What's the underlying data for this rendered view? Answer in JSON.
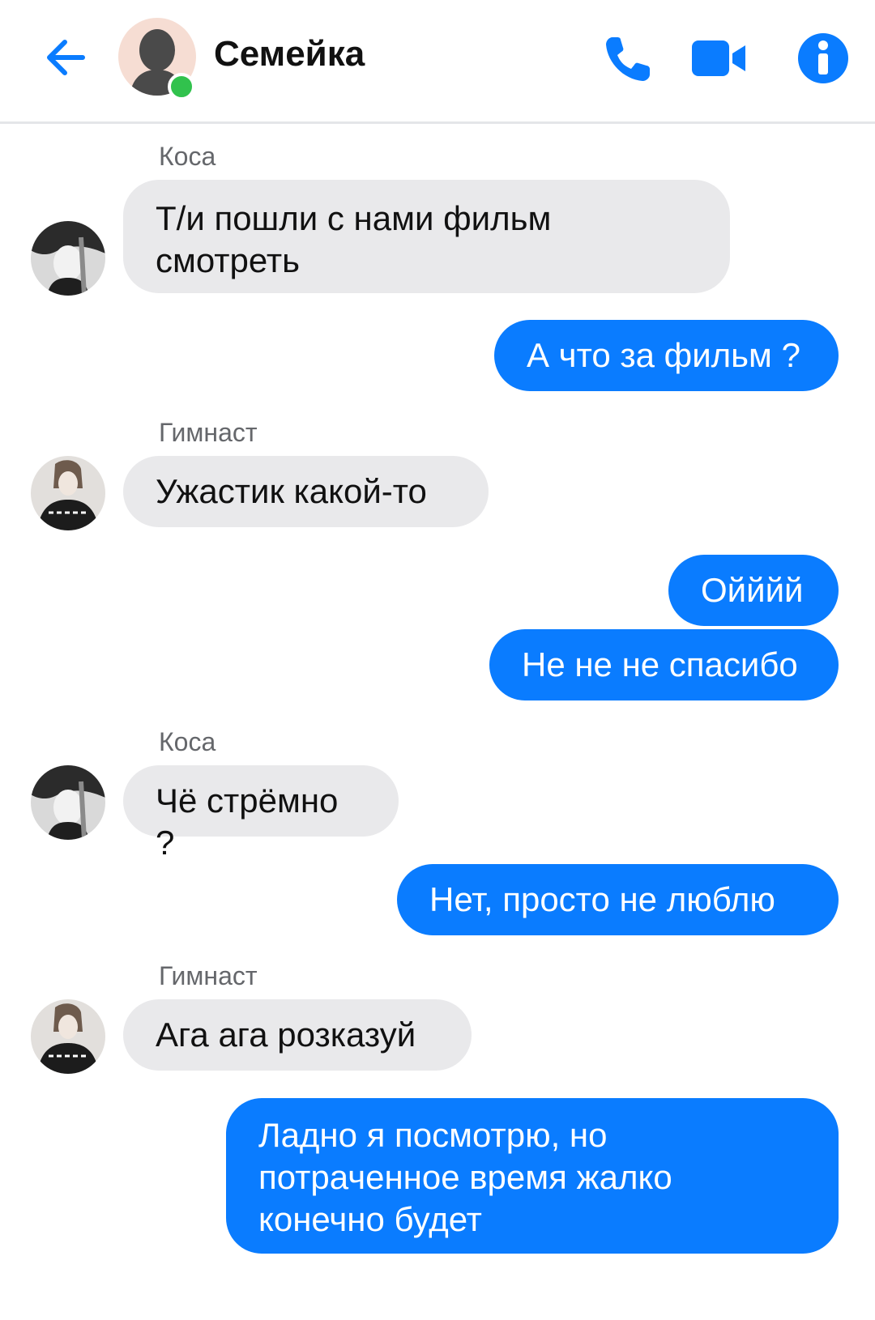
{
  "header": {
    "title": "Семейка",
    "back_icon": "arrow-left-icon",
    "call_icon": "phone-icon",
    "video_icon": "video-camera-icon",
    "info_icon": "info-icon",
    "accent_color": "#0a7cff",
    "online_color": "#31c24d"
  },
  "messages": [
    {
      "sender": "Коса",
      "text": "Т/и пошли с нами фильм смотреть",
      "direction": "incoming"
    },
    {
      "text": "А что за фильм ?",
      "direction": "outgoing"
    },
    {
      "sender": "Гимнаст",
      "text": "Ужастик какой-то",
      "direction": "incoming"
    },
    {
      "text": "Ойййй",
      "direction": "outgoing"
    },
    {
      "text": "Не не не спасибо",
      "direction": "outgoing"
    },
    {
      "sender": "Коса",
      "text": "Чё стрёмно ?",
      "direction": "incoming"
    },
    {
      "text": "Нет, просто не люблю",
      "direction": "outgoing"
    },
    {
      "sender": "Гимнаст",
      "text": "Ага ага розказуй",
      "direction": "incoming"
    },
    {
      "text": "Ладно я посмотрю, но потраченное время жалко конечно будет",
      "direction": "outgoing"
    }
  ],
  "colors": {
    "incoming_bubble": "#e9e9eb",
    "outgoing_bubble": "#0a7cff"
  }
}
